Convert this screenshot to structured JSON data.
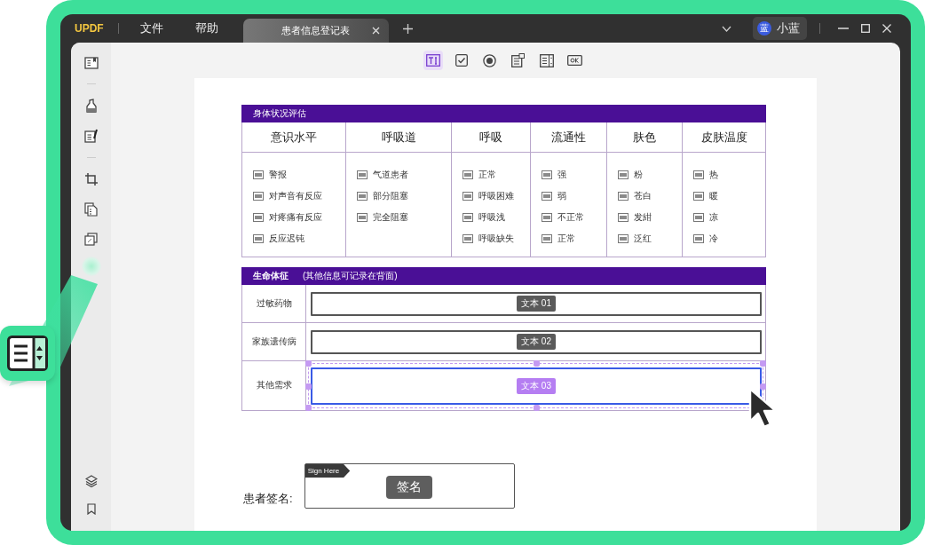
{
  "app": {
    "logo": "UPDF",
    "menu": [
      "文件",
      "帮助"
    ],
    "tabs": [
      {
        "label": "患者信息登记表",
        "selected": true
      }
    ],
    "user": {
      "avatar": "蓝",
      "name": "小蓝"
    }
  },
  "tools": [
    {
      "kind": "text",
      "selected": true
    },
    {
      "kind": "checkbox",
      "selected": false
    },
    {
      "kind": "radio",
      "selected": false
    },
    {
      "kind": "combo",
      "selected": false
    },
    {
      "kind": "list",
      "selected": false
    },
    {
      "kind": "button",
      "selected": false
    }
  ],
  "assessment": {
    "title": "身体状况评估",
    "columns": [
      {
        "heading": "意识水平",
        "options": [
          "警报",
          "对声音有反应",
          "对疼痛有反应",
          "反应迟钝"
        ]
      },
      {
        "heading": "呼吸道",
        "options": [
          "气道患者",
          "部分阻塞",
          "完全阻塞"
        ]
      },
      {
        "heading": "呼吸",
        "options": [
          "正常",
          "呼吸困难",
          "呼吸浅",
          "呼吸缺失"
        ]
      },
      {
        "heading": "流通性",
        "options": [
          "强",
          "弱",
          "不正常",
          "正常"
        ]
      },
      {
        "heading": "肤色",
        "options": [
          "粉",
          "苍白",
          "发紺",
          "泛红"
        ]
      },
      {
        "heading": "皮肤温度",
        "options": [
          "热",
          "暖",
          "凉",
          "冷"
        ]
      }
    ]
  },
  "vitals": {
    "title": "生命体征",
    "note": "(其他信息可记录在背面)",
    "rows": [
      {
        "label": "过敏药物",
        "field": "文本 01",
        "selected": false
      },
      {
        "label": "家族遗传病",
        "field": "文本 02",
        "selected": false
      },
      {
        "label": "其他需求",
        "field": "文本 03",
        "selected": true
      }
    ]
  },
  "signature": {
    "label": "患者签名:",
    "tag": "Sign Here",
    "field": "签名"
  }
}
